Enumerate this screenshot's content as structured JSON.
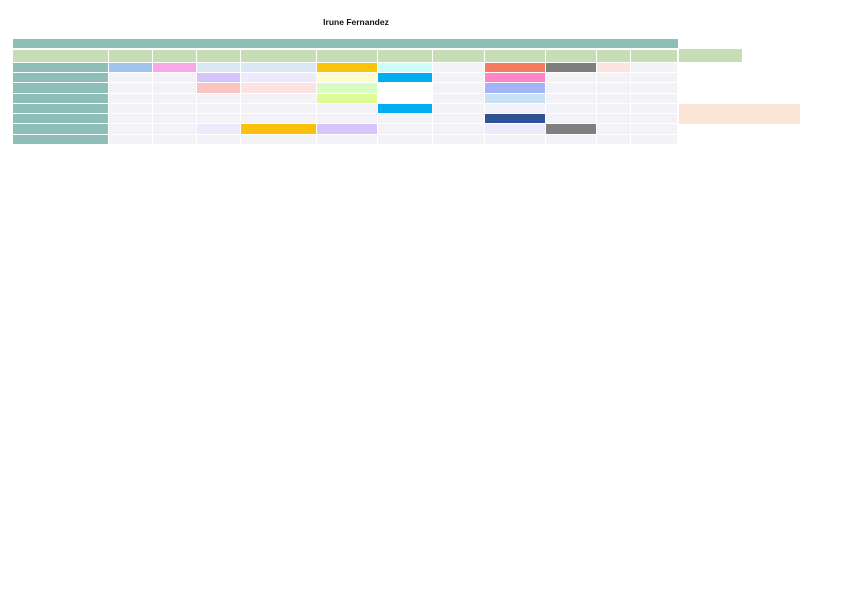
{
  "document": {
    "title": "Irune Fernandez"
  },
  "colors": {
    "header_bar": "#8dbfb8",
    "header_row": "#c6deb5",
    "row_label": "#8dbfb8",
    "empty_cell": "#f2f2f7",
    "side_note": "#fbe5d6"
  },
  "grid": {
    "column_count": 13,
    "row_count": 9,
    "header_row_colors": [
      "#c6deb5",
      "#c6deb5",
      "#c6deb5",
      "#c6deb5",
      "#c6deb5",
      "#c6deb5",
      "#c6deb5",
      "#c6deb5",
      "#c6deb5",
      "#c6deb5",
      "#c6deb5",
      "#c6deb5",
      "#dae8f5"
    ],
    "rows": [
      [
        "#8dbfb8",
        "#a2c3ec",
        "#f8a8e8",
        "#dae8f5",
        "#dae8f5",
        "#fcc30b",
        "#ccfcfc",
        "#f2f2f7",
        "#f57a5e",
        "#7f7f7f",
        "#fde2e2",
        "#f2f2f7"
      ],
      [
        "#8dbfb8",
        "#f2f2f7",
        "#f2f2f7",
        "#d6c4fc",
        "#efe9fc",
        "#fcfccc",
        "#00aeef",
        "#f2f2f7",
        "#ff86c6",
        "#f2f2f7",
        "#f2f2f7",
        "#f2f2f7"
      ],
      [
        "#8dbfb8",
        "#f2f2f7",
        "#f2f2f7",
        "#f8c5c0",
        "#fde2e2",
        "#d7fcc4",
        "#ffffff",
        "#f2f2f7",
        "#a2b4f5",
        "#f2f2f7",
        "#f2f2f7",
        "#f2f2f7"
      ],
      [
        "#8dbfb8",
        "#f2f2f7",
        "#f2f2f7",
        "#f2f2f7",
        "#f2f2f7",
        "#ddfc98",
        "#ffffff",
        "#f2f2f7",
        "#c9e1f7",
        "#f2f2f7",
        "#f2f2f7",
        "#f2f2f7"
      ],
      [
        "#8dbfb8",
        "#f2f2f7",
        "#f2f2f7",
        "#f2f2f7",
        "#f2f2f7",
        "#f2f2f7",
        "#00aeef",
        "#f2f2f7",
        "#f2f2f7",
        "#f2f2f7",
        "#f2f2f7",
        "#f2f2f7"
      ],
      [
        "#8dbfb8",
        "#f2f2f7",
        "#f2f2f7",
        "#f2f2f7",
        "#f2f2f7",
        "#f2f2f7",
        "#f2f2f7",
        "#f2f2f7",
        "#2f5496",
        "#f2f2f7",
        "#f2f2f7",
        "#f2f2f7"
      ],
      [
        "#8dbfb8",
        "#f2f2f7",
        "#f2f2f7",
        "#efe9fc",
        "#fcbf0b",
        "#d6c4fc",
        "#f2f2f7",
        "#f2f2f7",
        "#efe9fc",
        "#7f7f7f",
        "#f2f2f7",
        "#f2f2f7"
      ],
      [
        "#8dbfb8",
        "#f2f2f7",
        "#f2f2f7",
        "#f2f2f7",
        "#f2f2f7",
        "#f2f2f7",
        "#f2f2f7",
        "#f2f2f7",
        "#f2f2f7",
        "#f2f2f7",
        "#f2f2f7",
        "#f2f2f7"
      ]
    ],
    "side_blocks": [
      {
        "color": "#c6deb5"
      },
      {
        "color": "#fbe5d6"
      }
    ]
  }
}
